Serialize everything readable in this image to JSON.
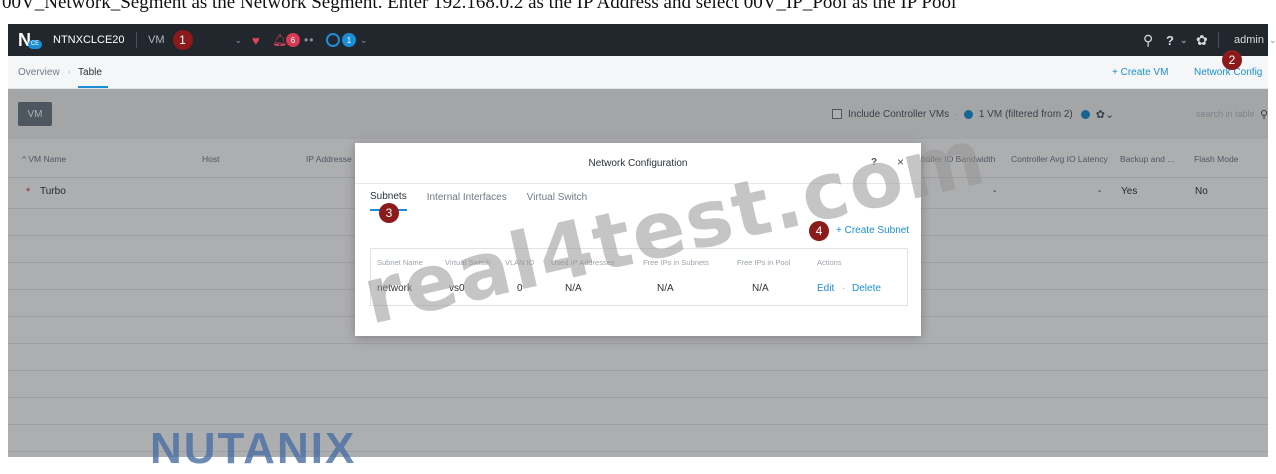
{
  "caption": "00V_Network_Segment as the Network Segment. Enter 192.168.0.2 as the IP Address and select 00V_IP_Pool as the IP Pool",
  "topbar": {
    "cluster_name": "NTNXCLCE20",
    "logo_badge": "CE",
    "menu_label": "VM",
    "alert_count": "6",
    "task_count": "1",
    "help": "?",
    "user": "admin"
  },
  "subnav": {
    "crumb_overview": "Overview",
    "crumb_table": "Table",
    "create_vm": "+ Create VM",
    "network_config": "Network Config"
  },
  "toolbar": {
    "vm_button": "VM",
    "include_cvm": "Include Controller VMs",
    "vm_count": "1 VM (filtered from 2)",
    "search_placeholder": "search in table"
  },
  "table": {
    "headers": {
      "vm_name": "^ VM Name",
      "host": "Host",
      "ip": "IP Addresse",
      "io_bw": "ntroller IO Bandwidth",
      "io_lat": "Controller Avg IO Latency",
      "backup": "Backup and ...",
      "flash": "Flash Mode"
    },
    "rows": [
      {
        "name": "Turbo",
        "io_bw": "-",
        "io_lat": "-",
        "backup": "Yes",
        "flash": "No"
      }
    ]
  },
  "modal": {
    "title": "Network Configuration",
    "help": "?",
    "close": "×",
    "tabs": [
      "Subnets",
      "Internal Interfaces",
      "Virtual Switch"
    ],
    "create_subnet": "+ Create Subnet",
    "columns": [
      "Subnet Name",
      "Virtual Switch",
      "VLAN ID",
      "Used IP Addresses",
      "Free IPs in Subnets",
      "Free IPs in Pool",
      "Actions"
    ],
    "rows": [
      {
        "name": "network",
        "vswitch": "vs0",
        "vlan": "0",
        "used": "N/A",
        "free_subnet": "N/A",
        "free_pool": "N/A",
        "edit": "Edit",
        "delete": "Delete"
      }
    ]
  },
  "markers": [
    "1",
    "2",
    "3",
    "4"
  ],
  "watermark": "real4test.com",
  "brand": "NUTANIX"
}
